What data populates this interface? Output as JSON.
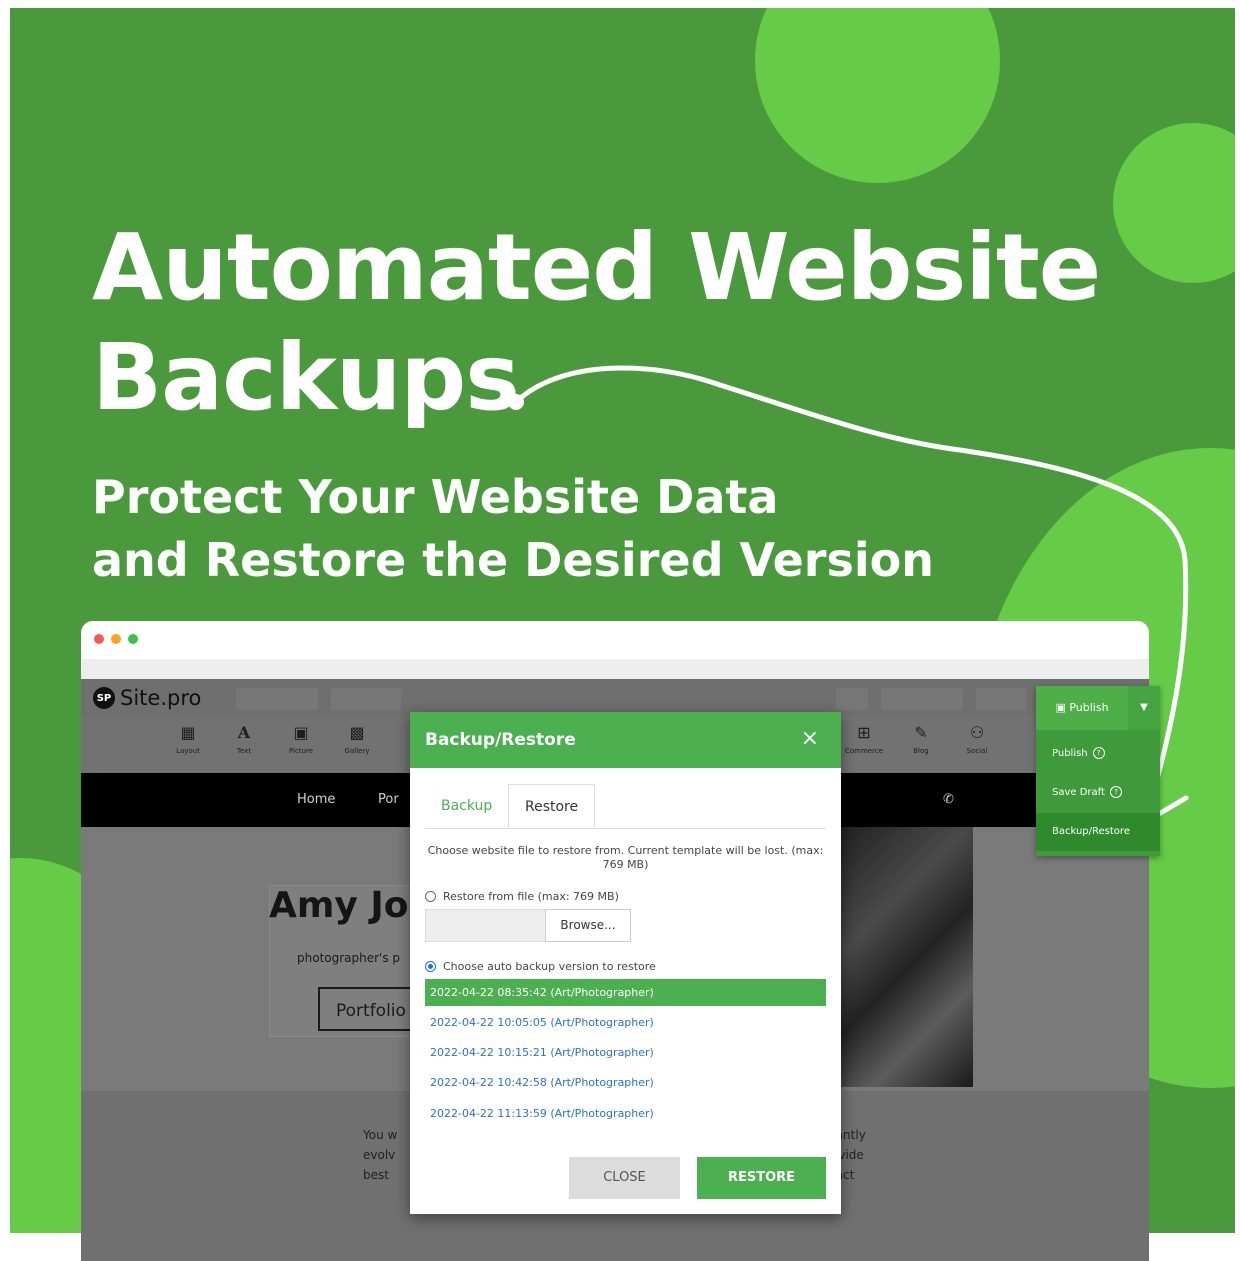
{
  "headline": {
    "line1": "Automated Website",
    "line2": "Backups"
  },
  "subheadline": {
    "line1": "Protect Your Website Data",
    "line2": "and Restore the Desired Version"
  },
  "colors": {
    "background_green": "#4a9a3d",
    "accent_green": "#66cc47",
    "button_green": "#4caf50",
    "link_blue": "#2a73c8"
  },
  "editor": {
    "logo_mark": "SP",
    "logo_text": "Site.pro",
    "tools": [
      {
        "icon": "layout-icon",
        "label": "Layout"
      },
      {
        "icon": "text-icon",
        "label": "Text"
      },
      {
        "icon": "picture-icon",
        "label": "Picture"
      },
      {
        "icon": "gallery-icon",
        "label": "Gallery"
      },
      {
        "icon": "commerce-icon",
        "label": "Commerce"
      },
      {
        "icon": "blog-icon",
        "label": "Blog"
      },
      {
        "icon": "social-icon",
        "label": "Social"
      }
    ],
    "nav": {
      "home": "Home",
      "por": "Por"
    },
    "site_name": "Amy Jo",
    "tagline": "photographer's p",
    "portfolio_button": "Portfolio",
    "lower_left": [
      "You w",
      "evolv",
      "best"
    ],
    "lower_right": [
      "tantly",
      "ovide",
      "tact"
    ]
  },
  "publish_menu": {
    "publish_button": "Publish",
    "items": [
      "Publish",
      "Save Draft",
      "Backup/Restore"
    ],
    "help_mark": "?"
  },
  "modal": {
    "title": "Backup/Restore",
    "close_symbol": "×",
    "tabs": [
      "Backup",
      "Restore"
    ],
    "info": "Choose website file to restore from. Current template will be lost. (max: 769 MB)",
    "restore_from_file": "Restore from file (max: 769 MB)",
    "browse": "Browse...",
    "choose_auto": "Choose auto backup version to restore",
    "versions": [
      "2022-04-22 08:35:42 (Art/Photographer)",
      "2022-04-22 10:05:05 (Art/Photographer)",
      "2022-04-22 10:15:21 (Art/Photographer)",
      "2022-04-22 10:42:58 (Art/Photographer)",
      "2022-04-22 11:13:59 (Art/Photographer)"
    ],
    "selected_version_index": 0,
    "close_button": "CLOSE",
    "restore_button": "RESTORE"
  }
}
